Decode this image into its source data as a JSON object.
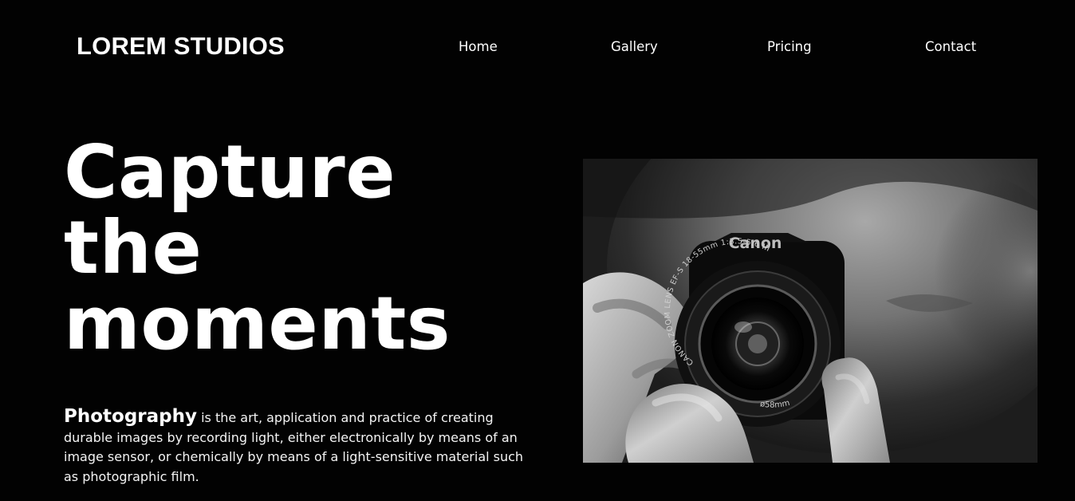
{
  "header": {
    "brand": "LOREM STUDIOS",
    "nav": [
      {
        "label": "Home"
      },
      {
        "label": "Gallery"
      },
      {
        "label": "Pricing"
      },
      {
        "label": "Contact"
      }
    ]
  },
  "hero": {
    "title_lines": [
      "Capture",
      "the",
      "moments"
    ],
    "description_term": "Photography",
    "description_text": " is the art, application and practice of creating durable images by recording light, either electronically by means of an image sensor, or chemically by means of a light-sensitive material such as photographic film."
  },
  "image": {
    "camera_brand": "Canon",
    "lens_text_left": "CANON ZOOM LENS EF-S 18-55mm 1:3.5-5.6 III",
    "lens_text_bottom": "ø58mm"
  },
  "colors": {
    "background": "#020202",
    "text": "#ffffff"
  }
}
